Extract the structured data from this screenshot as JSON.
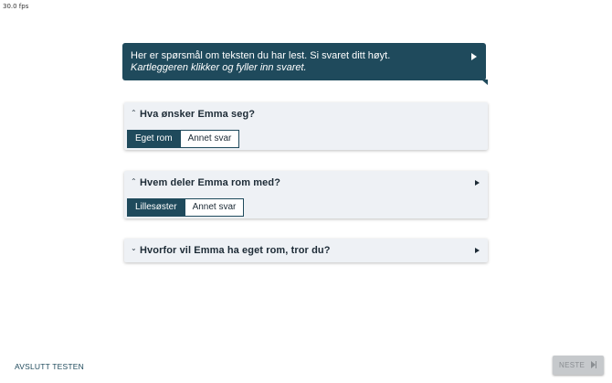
{
  "fps": "30.0 fps",
  "prompt": {
    "line1": "Her er spørsmål om teksten du har lest. Si svaret ditt høyt.",
    "line2": "Kartleggeren klikker og fyller inn svaret."
  },
  "questions": [
    {
      "text": "Hva ønsker Emma seg?",
      "expanded": true,
      "options": [
        "Eget rom",
        "Annet svar"
      ],
      "selected": "Eget rom"
    },
    {
      "text": "Hvem deler Emma rom med?",
      "expanded": true,
      "options": [
        "Lillesøster",
        "Annet svar"
      ],
      "selected": "Lillesøster"
    },
    {
      "text": "Hvorfor vil Emma ha eget rom, tror du?",
      "expanded": false
    }
  ],
  "footer": {
    "finish_label": "AVSLUTT TESTEN",
    "next_label": "NESTE"
  },
  "colors": {
    "accent": "#1f4a5c",
    "card_bg": "#eef1f5",
    "disabled": "#c6c9cc"
  }
}
